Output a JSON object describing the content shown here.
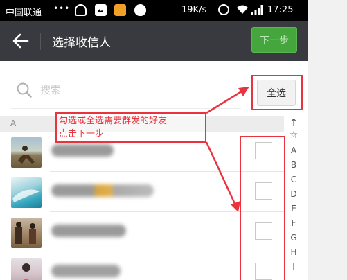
{
  "status_bar": {
    "carrier": "中国联通",
    "dots": "•••",
    "net_speed": "19K/s",
    "time": "17:25",
    "icons": [
      "usb-icon",
      "image-icon",
      "game-icon",
      "cat-icon",
      "alarm-icon",
      "wifi-icon",
      "signal-icon",
      "battery-icon"
    ]
  },
  "header": {
    "title": "选择收信人",
    "next_label": "下一步",
    "back_icon": "arrow-left-icon"
  },
  "search": {
    "placeholder": "搜索",
    "select_all_label": "全选"
  },
  "section": {
    "letter": "A"
  },
  "contacts": [
    {
      "name": "■■■■",
      "checked": false
    },
    {
      "name": "■■■■■■■■",
      "checked": false
    },
    {
      "name": "■■■■■■",
      "checked": false
    },
    {
      "name": "■■■■■",
      "checked": false
    }
  ],
  "index_bar": [
    "↑",
    "☆",
    "A",
    "B",
    "C",
    "D",
    "E",
    "F",
    "G",
    "H",
    "I"
  ],
  "annotation": {
    "line1": "勾选或全选需要群发的好友",
    "line2": "点击下一步"
  },
  "colors": {
    "header_bg": "#393a3f",
    "next_button": "#45a63d",
    "annotation": "#e8343f"
  }
}
